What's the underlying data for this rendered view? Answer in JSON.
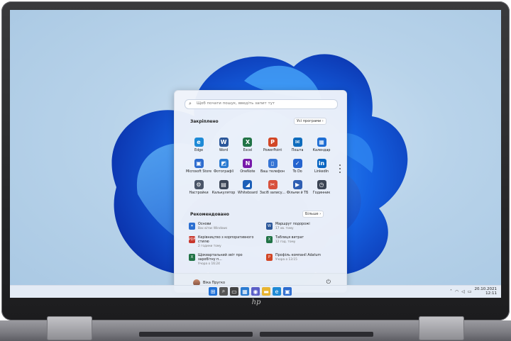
{
  "start_menu": {
    "search_placeholder": "Щоб почати пошук, введіть запит тут",
    "pinned_title": "Закріплено",
    "all_apps_label": "Усі програми  ›",
    "pinned": [
      {
        "label": "Edge",
        "icon": "edge-icon",
        "color": "#1e8ad6",
        "glyph": "e"
      },
      {
        "label": "Word",
        "icon": "word-icon",
        "color": "#2b579a",
        "glyph": "W"
      },
      {
        "label": "Excel",
        "icon": "excel-icon",
        "color": "#217346",
        "glyph": "X"
      },
      {
        "label": "PowerPoint",
        "icon": "powerpoint-icon",
        "color": "#d24726",
        "glyph": "P"
      },
      {
        "label": "Пошта",
        "icon": "mail-icon",
        "color": "#0f6cbd",
        "glyph": "✉"
      },
      {
        "label": "Календар",
        "icon": "calendar-icon",
        "color": "#1f6ed4",
        "glyph": "▦"
      },
      {
        "label": "Microsoft Store",
        "icon": "store-icon",
        "color": "#2d6ccf",
        "glyph": "▣"
      },
      {
        "label": "Фотографії",
        "icon": "photos-icon",
        "color": "#2a7bd1",
        "glyph": "◩"
      },
      {
        "label": "OneNote",
        "icon": "onenote-icon",
        "color": "#7719aa",
        "glyph": "N"
      },
      {
        "label": "Ваш телефон",
        "icon": "phone-icon",
        "color": "#3574d4",
        "glyph": "▯"
      },
      {
        "label": "To Do",
        "icon": "todo-icon",
        "color": "#2564cf",
        "glyph": "✓"
      },
      {
        "label": "LinkedIn",
        "icon": "linkedin-icon",
        "color": "#0a66c2",
        "glyph": "in"
      },
      {
        "label": "Настройки",
        "icon": "settings-icon",
        "color": "#4a5568",
        "glyph": "⚙"
      },
      {
        "label": "Калькулятор",
        "icon": "calculator-icon",
        "color": "#3c4657",
        "glyph": "▤"
      },
      {
        "label": "Whiteboard",
        "icon": "whiteboard-icon",
        "color": "#1c5fb8",
        "glyph": "◢"
      },
      {
        "label": "Засіб запису...",
        "icon": "snipping-icon",
        "color": "#d8513d",
        "glyph": "✂"
      },
      {
        "label": "Фільми й ТБ",
        "icon": "movies-icon",
        "color": "#2f5fb3",
        "glyph": "▶"
      },
      {
        "label": "Годинник",
        "icon": "clock-icon",
        "color": "#3b4454",
        "glyph": "◷"
      }
    ],
    "recommended_title": "Рекомендовано",
    "more_label": "Більше  ›",
    "recommended": [
      {
        "title": "Основи",
        "sub": "Вас вітає Windows",
        "icon": "tips-icon",
        "color": "#2b6fd1",
        "glyph": "✦"
      },
      {
        "title": "Маршрут подорожі",
        "sub": "17 хв. тому",
        "icon": "word-doc-icon",
        "color": "#2b579a",
        "glyph": "W"
      },
      {
        "title": "Керівництво з корпоративного стилю",
        "sub": "2 години тому",
        "icon": "pdf-icon",
        "color": "#c8372d",
        "glyph": "PDF"
      },
      {
        "title": "Таблиця витрат",
        "sub": "12 год. тому",
        "icon": "excel-doc-icon",
        "color": "#217346",
        "glyph": "X"
      },
      {
        "title": "Щоквартальний звіт про заробітну п...",
        "sub": "Учора о 16:24",
        "icon": "excel-doc-icon",
        "color": "#217346",
        "glyph": "X"
      },
      {
        "title": "Профіль компанії Adatum",
        "sub": "Учора о 13:15",
        "icon": "powerpoint-doc-icon",
        "color": "#d24726",
        "glyph": "P"
      }
    ],
    "user_name": "Віка Пругко"
  },
  "taskbar": {
    "icons": [
      {
        "name": "start-icon",
        "color": "#1e6fd6",
        "glyph": "⊞"
      },
      {
        "name": "search-icon",
        "color": "#555555",
        "glyph": "⌕"
      },
      {
        "name": "task-view-icon",
        "color": "#444444",
        "glyph": "▭"
      },
      {
        "name": "widgets-icon",
        "color": "#2a7bd1",
        "glyph": "▦"
      },
      {
        "name": "chat-icon",
        "color": "#5b5fc7",
        "glyph": "◉"
      },
      {
        "name": "explorer-icon",
        "color": "#e8b531",
        "glyph": "▬"
      },
      {
        "name": "edge-taskbar-icon",
        "color": "#1e8ad6",
        "glyph": "e"
      },
      {
        "name": "store-taskbar-icon",
        "color": "#2d6ccf",
        "glyph": "▣"
      }
    ],
    "date": "20.10.2021",
    "time": "12:11"
  },
  "brand": "hp"
}
